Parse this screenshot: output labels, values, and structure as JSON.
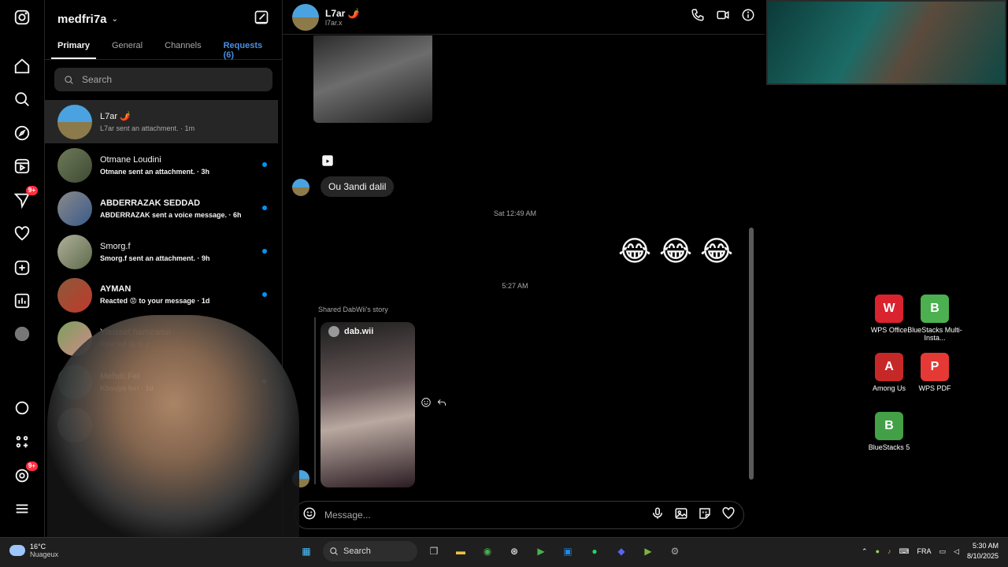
{
  "rail": {
    "icons": [
      "instagram-icon",
      "home-icon",
      "search-icon",
      "explore-icon",
      "reels-icon",
      "messages-icon",
      "notifications-icon",
      "create-icon",
      "dashboard-icon",
      "profile-icon",
      "threads-icon",
      "apps-icon",
      "more-icon"
    ],
    "messages_badge": "9+",
    "threads_badge": "9+"
  },
  "inbox": {
    "account": "medfri7a",
    "tabs": [
      "Primary",
      "General",
      "Channels",
      "Requests (6)"
    ],
    "search_placeholder": "Search",
    "conversations": [
      {
        "name": "L7ar 🌶️",
        "preview": "L7ar sent an attachment. · 1m",
        "unread": false,
        "selected": true
      },
      {
        "name": "Otmane Loudini",
        "preview": "Otmane sent an attachment. · 3h",
        "unread": true
      },
      {
        "name": "ABDERRAZAK SEDDAD",
        "preview": "ABDERRAZAK sent a voice message. · 6h",
        "unread": true
      },
      {
        "name": "Smorg.f",
        "preview": "Smorg.f sent an attachment. · 9h",
        "unread": true
      },
      {
        "name": "AYMAN",
        "preview": "Reacted 😡 to your message · 1d",
        "unread": true
      },
      {
        "name": "Youssef hamzaoui",
        "preview": "Reacted 😡 to y",
        "unread": false
      },
      {
        "name": "Mehdi Fel",
        "preview": "Khouya feri · 1d",
        "unread": true
      }
    ]
  },
  "chat": {
    "name": "L7ar 🌶️",
    "handle": "l7ar.x",
    "message_text": "Ou 3andi dalil",
    "timestamp_1": "Sat 12:49 AM",
    "emojis": [
      "😂",
      "😂",
      "😂"
    ],
    "timestamp_2": "5:27 AM",
    "shared_label": "Shared DabWii's story",
    "story_user": "dab.wii",
    "composer_placeholder": "Message..."
  },
  "desktop": {
    "icons": [
      {
        "label": "WPS Office",
        "color": "#d9232e",
        "glyph": "W"
      },
      {
        "label": "BlueStacks Multi-Insta...",
        "color": "#4caf50",
        "glyph": "B"
      },
      {
        "label": "Among Us",
        "color": "#c62828",
        "glyph": "A"
      },
      {
        "label": "WPS PDF",
        "color": "#e53935",
        "glyph": "P"
      },
      {
        "label": "BlueStacks 5",
        "color": "#43a047",
        "glyph": "B"
      }
    ]
  },
  "taskbar": {
    "weather_temp": "16°C",
    "weather_desc": "Nuageux",
    "search_label": "Search",
    "lang": "FRA",
    "time": "5:30 AM",
    "date": "8/10/2025"
  }
}
